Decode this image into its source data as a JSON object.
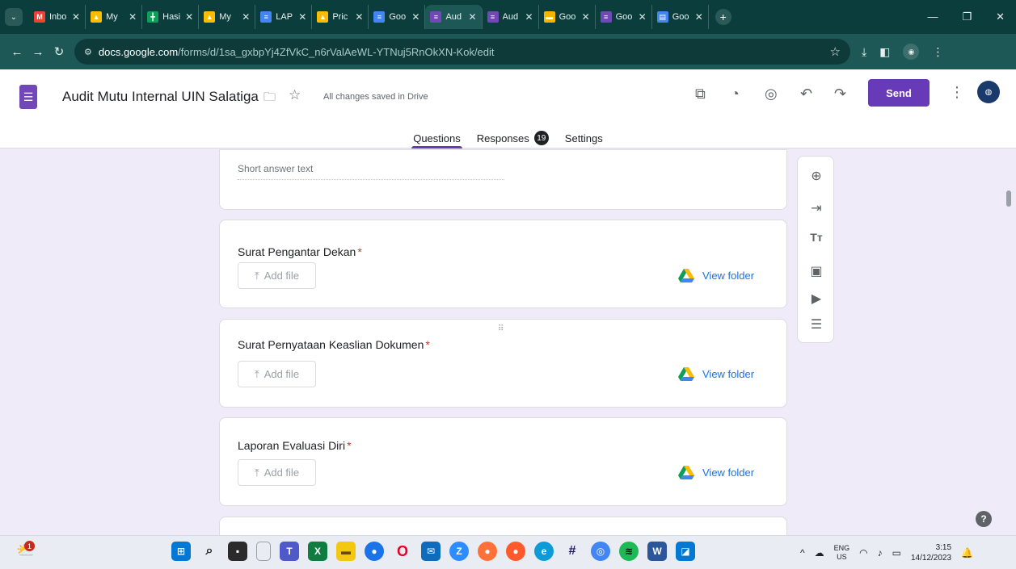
{
  "browser": {
    "tabs": [
      {
        "label": "Inbo",
        "icon": "gmail-icon",
        "color": "#ea4335",
        "glyph": "M"
      },
      {
        "label": "My",
        "icon": "drive-icon",
        "color": "#fbbc04",
        "glyph": "▲"
      },
      {
        "label": "Hasi",
        "icon": "sheets-icon",
        "color": "#0f9d58",
        "glyph": "╋"
      },
      {
        "label": "My",
        "icon": "drive-icon",
        "color": "#fbbc04",
        "glyph": "▲"
      },
      {
        "label": "LAP",
        "icon": "docs-icon",
        "color": "#4285f4",
        "glyph": "≡"
      },
      {
        "label": "Pric",
        "icon": "drive-icon",
        "color": "#fbbc04",
        "glyph": "▲"
      },
      {
        "label": "Goo",
        "icon": "docs-icon",
        "color": "#4285f4",
        "glyph": "≡"
      },
      {
        "label": "Aud",
        "icon": "forms-icon",
        "color": "#7248b9",
        "glyph": "≡",
        "active": true
      },
      {
        "label": "Aud",
        "icon": "forms-icon",
        "color": "#7248b9",
        "glyph": "≡"
      },
      {
        "label": "Goo",
        "icon": "slides-icon",
        "color": "#f4b400",
        "glyph": "▬"
      },
      {
        "label": "Goo",
        "icon": "forms-icon",
        "color": "#7248b9",
        "glyph": "≡"
      },
      {
        "label": "Goo",
        "icon": "classroom-icon",
        "color": "#4285f4",
        "glyph": "▤"
      }
    ],
    "url_host": "docs.google.com",
    "url_path": "/forms/d/1sa_gxbpYj4ZfVkC_n6rValAeWL-YTNuj5RnOkXN-Kok/edit"
  },
  "form": {
    "title": "Audit Mutu Internal UIN Salatiga",
    "save_status": "All changes saved in Drive",
    "send_label": "Send",
    "tabs": {
      "questions": "Questions",
      "responses": "Responses",
      "responses_count": "19",
      "settings": "Settings"
    },
    "short_answer_placeholder": "Short answer text",
    "questions": [
      {
        "title": "Surat Pengantar Dekan",
        "required": "*",
        "add_file": "Add file",
        "view_folder": "View folder"
      },
      {
        "title": "Surat Pernyataan Keaslian Dokumen",
        "required": "*",
        "add_file": "Add file",
        "view_folder": "View folder"
      },
      {
        "title": "Laporan Evaluasi Diri",
        "required": "*",
        "add_file": "Add file",
        "view_folder": "View folder"
      }
    ]
  },
  "taskbar": {
    "notification_count": "1",
    "lang_top": "ENG",
    "lang_bottom": "US",
    "time": "3:15",
    "date": "14/12/2023"
  },
  "colors": {
    "accent": "#673ab7",
    "chrome_dark": "#0b3d3c",
    "chrome_toolbar": "#1e5856",
    "background": "#f0ebf8",
    "link": "#1a73e8",
    "required": "#d93025"
  }
}
